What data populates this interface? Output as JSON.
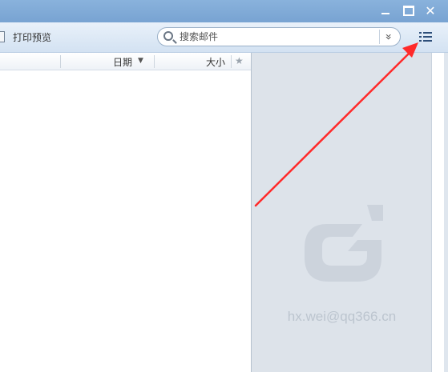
{
  "toolbar": {
    "print_preview_label": "打印预览",
    "search": {
      "placeholder": "搜索邮件",
      "value": ""
    }
  },
  "columns": {
    "date_label": "日期",
    "size_label": "大小"
  },
  "preview": {
    "watermark": "hx.wei@qq366.cn"
  },
  "icons": {
    "minimize": "minimize-icon",
    "maximize": "maximize-icon",
    "close": "close-icon",
    "print": "printer-icon",
    "search": "search-icon",
    "dropdown": "double-chevron-down-icon",
    "list_view": "list-view-icon",
    "sort": "chevron-down-icon",
    "star": "star-icon",
    "logo": "g-logo-icon"
  },
  "colors": {
    "titlebar": "#80abd7",
    "toolbar": "#dfe9f5",
    "preview_bg": "#dde3ea",
    "annotation_arrow": "#ff2a2a"
  }
}
